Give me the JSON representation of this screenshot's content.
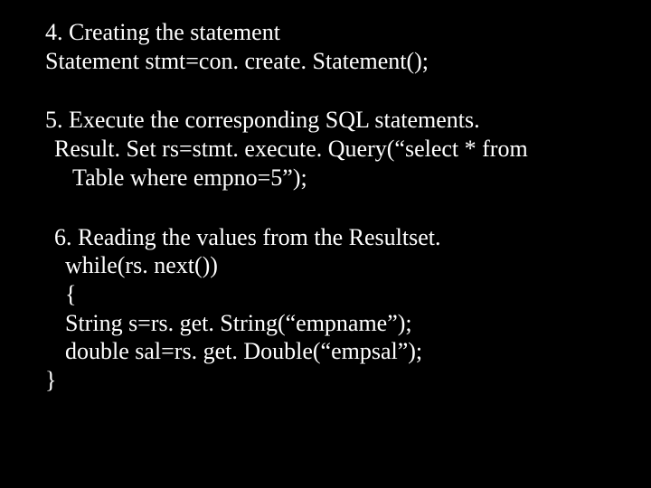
{
  "section4": {
    "title": "4. Creating the statement",
    "code1": "Statement stmt=con. create. Statement();"
  },
  "section5": {
    "title": "5. Execute the corresponding SQL statements.",
    "code1": "Result. Set rs=stmt. execute. Query(“select * from",
    "code2": "Table where empno=5”);"
  },
  "section6": {
    "title": "6. Reading the values from the Resultset.",
    "code1": "while(rs. next())",
    "code2": "{",
    "code3": "String s=rs. get. String(“empname”);",
    "code4": "double sal=rs. get. Double(“empsal”);",
    "code5": "}"
  }
}
